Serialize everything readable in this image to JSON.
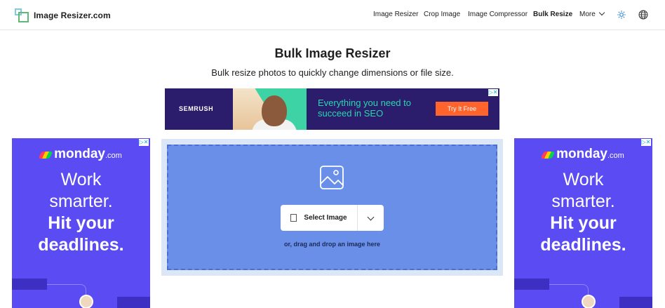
{
  "header": {
    "brand": "Image Resizer.com",
    "nav": [
      {
        "label": "Image Resizer",
        "active": false
      },
      {
        "label": "Crop Image",
        "active": false
      },
      {
        "label": "Image Compressor",
        "active": false
      },
      {
        "label": "Bulk Resize",
        "active": true
      },
      {
        "label": "More",
        "active": false
      }
    ],
    "icons": [
      "theme-sun-icon",
      "language-globe-icon"
    ]
  },
  "page": {
    "title": "Bulk Image Resizer",
    "subtitle": "Bulk resize photos to quickly change dimensions or file size."
  },
  "ad_top": {
    "brand": "SEMRUSH",
    "headline": "Everything you need to succeed in SEO",
    "cta": "Try It Free"
  },
  "ad_side": {
    "brand": "monday",
    "brand_suffix": ".com",
    "line1": "Work",
    "line2": "smarter.",
    "line3": "Hit your",
    "line4": "deadlines."
  },
  "upload": {
    "select_label": "Select Image",
    "drag_text": "or, drag and drop an image here"
  },
  "colors": {
    "dropzone_bg": "#6a8fe8",
    "dropzone_outer": "#dbe6f6",
    "ad_side_bg": "#5b4bf2",
    "ad_top_bg": "#2b1d6b",
    "cta_orange": "#ff642d"
  }
}
